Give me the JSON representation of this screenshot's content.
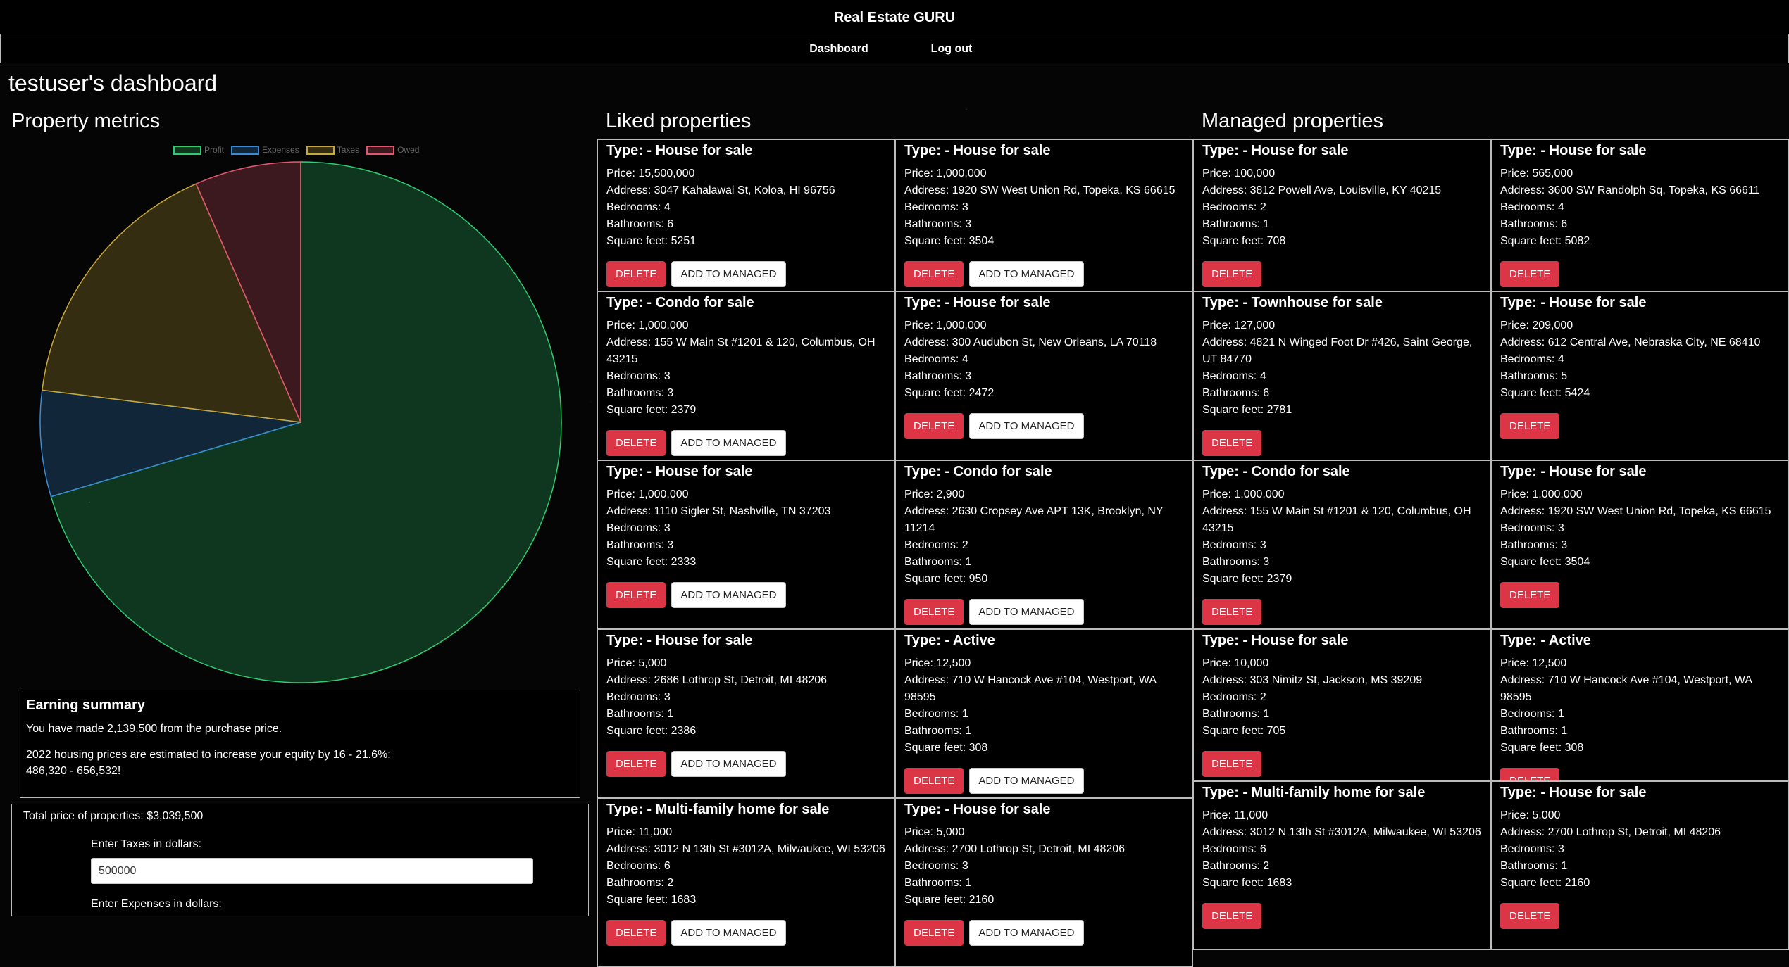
{
  "header": {
    "title": "Real Estate GURU"
  },
  "nav": {
    "dashboard": "Dashboard",
    "logout": "Log out"
  },
  "dashboard": {
    "title": "testuser's dashboard"
  },
  "sections": {
    "metrics": "Property metrics",
    "liked": "Liked properties",
    "managed": "Managed properties"
  },
  "chart_data": {
    "type": "pie",
    "categories": [
      "Profit",
      "Expenses",
      "Taxes",
      "Owed"
    ],
    "values": [
      2139500,
      200000,
      500000,
      200000
    ],
    "colors": [
      "#2ecc71",
      "#3a8bd6",
      "#c9a83a",
      "#e0566f"
    ],
    "legend_position": "top"
  },
  "earning": {
    "title": "Earning summary",
    "line1": "You have made 2,139,500 from the purchase price.",
    "line2": "2022 housing prices are estimated to increase your equity by 16 - 21.6%:",
    "line3": "486,320 - 656,532!"
  },
  "totals": {
    "total": "Total price of properties: $3,039,500",
    "taxes_label": "Enter Taxes in dollars:",
    "taxes_value": "500000",
    "expenses_label": "Enter Expenses in dollars:"
  },
  "buttons": {
    "delete": "DELETE",
    "add_managed": "ADD TO MANAGED"
  },
  "liked": [
    {
      "type": "Type: - House for sale",
      "price": "Price: 15,500,000",
      "address": "Address: 3047 Kahalawai St, Koloa, HI 96756",
      "bedrooms": "Bedrooms: 4",
      "bathrooms": "Bathrooms: 6",
      "sqft": "Square feet: 5251"
    },
    {
      "type": "Type: - House for sale",
      "price": "Price: 1,000,000",
      "address": "Address: 1920 SW West Union Rd, Topeka, KS 66615",
      "bedrooms": "Bedrooms: 3",
      "bathrooms": "Bathrooms: 3",
      "sqft": "Square feet: 3504"
    },
    {
      "type": "Type: - Condo for sale",
      "price": "Price: 1,000,000",
      "address": "Address: 155 W Main St #1201 & 120, Columbus, OH 43215",
      "bedrooms": "Bedrooms: 3",
      "bathrooms": "Bathrooms: 3",
      "sqft": "Square feet: 2379"
    },
    {
      "type": "Type: - House for sale",
      "price": "Price: 1,000,000",
      "address": "Address: 300 Audubon St, New Orleans, LA 70118",
      "bedrooms": "Bedrooms: 4",
      "bathrooms": "Bathrooms: 3",
      "sqft": "Square feet: 2472"
    },
    {
      "type": "Type: - House for sale",
      "price": "Price: 1,000,000",
      "address": "Address: 1110 Sigler St, Nashville, TN 37203",
      "bedrooms": "Bedrooms: 3",
      "bathrooms": "Bathrooms: 3",
      "sqft": "Square feet: 2333"
    },
    {
      "type": "Type: - Condo for sale",
      "price": "Price: 2,900",
      "address": "Address: 2630 Cropsey Ave APT 13K, Brooklyn, NY 11214",
      "bedrooms": "Bedrooms: 2",
      "bathrooms": "Bathrooms: 1",
      "sqft": "Square feet: 950"
    },
    {
      "type": "Type: - House for sale",
      "price": "Price: 5,000",
      "address": "Address: 2686 Lothrop St, Detroit, MI 48206",
      "bedrooms": "Bedrooms: 3",
      "bathrooms": "Bathrooms: 1",
      "sqft": "Square feet: 2386"
    },
    {
      "type": "Type: - Active",
      "price": "Price: 12,500",
      "address": "Address: 710 W Hancock Ave #104, Westport, WA 98595",
      "bedrooms": "Bedrooms: 1",
      "bathrooms": "Bathrooms: 1",
      "sqft": "Square feet: 308"
    },
    {
      "type": "Type: - Multi-family home for sale",
      "price": "Price: 11,000",
      "address": "Address: 3012 N 13th St #3012A, Milwaukee, WI 53206",
      "bedrooms": "Bedrooms: 6",
      "bathrooms": "Bathrooms: 2",
      "sqft": "Square feet: 1683"
    },
    {
      "type": "Type: - House for sale",
      "price": "Price: 5,000",
      "address": "Address: 2700 Lothrop St, Detroit, MI 48206",
      "bedrooms": "Bedrooms: 3",
      "bathrooms": "Bathrooms: 1",
      "sqft": "Square feet: 2160"
    }
  ],
  "managed": [
    {
      "type": "Type: - House for sale",
      "price": "Price: 100,000",
      "address": "Address: 3812 Powell Ave, Louisville, KY 40215",
      "bedrooms": "Bedrooms: 2",
      "bathrooms": "Bathrooms: 1",
      "sqft": "Square feet: 708"
    },
    {
      "type": "Type: - House for sale",
      "price": "Price: 565,000",
      "address": "Address: 3600 SW Randolph Sq, Topeka, KS 66611",
      "bedrooms": "Bedrooms: 4",
      "bathrooms": "Bathrooms: 6",
      "sqft": "Square feet: 5082"
    },
    {
      "type": "Type: - Townhouse for sale",
      "price": "Price: 127,000",
      "address": "Address: 4821 N Winged Foot Dr #426, Saint George, UT 84770",
      "bedrooms": "Bedrooms: 4",
      "bathrooms": "Bathrooms: 6",
      "sqft": "Square feet: 2781"
    },
    {
      "type": "Type: - House for sale",
      "price": "Price: 209,000",
      "address": "Address: 612 Central Ave, Nebraska City, NE 68410",
      "bedrooms": "Bedrooms: 4",
      "bathrooms": "Bathrooms: 5",
      "sqft": "Square feet: 5424"
    },
    {
      "type": "Type: - Condo for sale",
      "price": "Price: 1,000,000",
      "address": "Address: 155 W Main St #1201 & 120, Columbus, OH 43215",
      "bedrooms": "Bedrooms: 3",
      "bathrooms": "Bathrooms: 3",
      "sqft": "Square feet: 2379"
    },
    {
      "type": "Type: - House for sale",
      "price": "Price: 1,000,000",
      "address": "Address: 1920 SW West Union Rd, Topeka, KS 66615",
      "bedrooms": "Bedrooms: 3",
      "bathrooms": "Bathrooms: 3",
      "sqft": "Square feet: 3504"
    },
    {
      "type": "Type: - House for sale",
      "price": "Price: 10,000",
      "address": "Address: 303 Nimitz St, Jackson, MS 39209",
      "bedrooms": "Bedrooms: 2",
      "bathrooms": "Bathrooms: 1",
      "sqft": "Square feet: 705"
    },
    {
      "type": "Type: - Active",
      "price": "Price: 12,500",
      "address": "Address: 710 W Hancock Ave #104, Westport, WA 98595",
      "bedrooms": "Bedrooms: 1",
      "bathrooms": "Bathrooms: 1",
      "sqft": "Square feet: 308"
    },
    {
      "type": "Type: - Multi-family home for sale",
      "price": "Price: 11,000",
      "address": "Address: 3012 N 13th St #3012A, Milwaukee, WI 53206",
      "bedrooms": "Bedrooms: 6",
      "bathrooms": "Bathrooms: 2",
      "sqft": "Square feet: 1683"
    },
    {
      "type": "Type: - House for sale",
      "price": "Price: 5,000",
      "address": "Address: 2700 Lothrop St, Detroit, MI 48206",
      "bedrooms": "Bedrooms: 3",
      "bathrooms": "Bathrooms: 1",
      "sqft": "Square feet: 2160"
    }
  ]
}
